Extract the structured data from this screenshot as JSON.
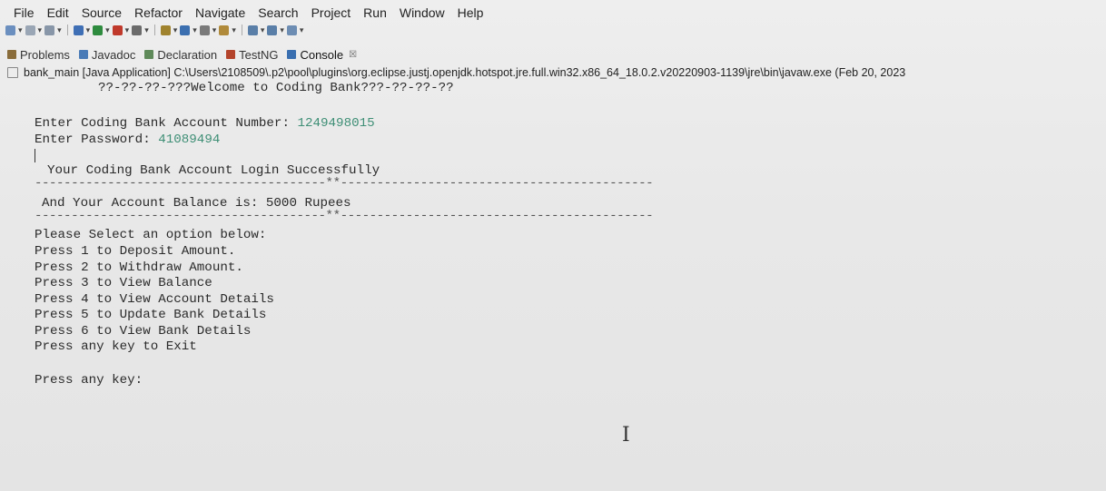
{
  "menu": [
    "File",
    "Edit",
    "Source",
    "Refactor",
    "Navigate",
    "Search",
    "Project",
    "Run",
    "Window",
    "Help"
  ],
  "toolbar": {
    "icons": [
      "new-icon",
      "save-icon",
      "save-all-icon",
      "debug-icon",
      "run-icon",
      "run-external-icon",
      "search-icon",
      "package-icon",
      "open-type-icon",
      "task-icon",
      "annotation-icon",
      "nav-back-icon",
      "nav-forward-icon",
      "new-window-icon"
    ]
  },
  "tabs": [
    {
      "label": "Problems",
      "icon": "problems-icon"
    },
    {
      "label": "Javadoc",
      "icon": "javadoc-icon"
    },
    {
      "label": "Declaration",
      "icon": "declaration-icon"
    },
    {
      "label": "TestNG",
      "icon": "testng-icon"
    },
    {
      "label": "Console",
      "icon": "console-icon",
      "close": "☒"
    }
  ],
  "launch": "bank_main [Java Application] C:\\Users\\2108509\\.p2\\pool\\plugins\\org.eclipse.justj.openjdk.hotspot.jre.full.win32.x86_64_18.0.2.v20220903-1139\\jre\\bin\\javaw.exe  (Feb 20, 2023",
  "console": {
    "welcome": "??-??-??-???Welcome to Coding Bank???-??-??-??",
    "account_prompt": "Enter Coding Bank Account Number: ",
    "account_value": "1249498015",
    "password_prompt": "Enter Password: ",
    "password_value": "41089494",
    "login_success": "Your Coding Bank Account Login Successfully",
    "divider": "----------------------------------------**-------------------------------------------",
    "balance": "And Your Account Balance is: 5000 Rupees",
    "options_header": "Please Select an option below:",
    "options": [
      "Press 1 to Deposit Amount.",
      "Press 2 to Withdraw Amount.",
      "Press 3 to View Balance",
      "Press 4 to View Account Details",
      "Press 5 to Update Bank Details",
      "Press 6 to View Bank Details",
      "Press any key to Exit"
    ],
    "prompt": "Press any key:"
  },
  "colors": {
    "input_text": "#3f8f76",
    "background": "#e9e9e9"
  }
}
